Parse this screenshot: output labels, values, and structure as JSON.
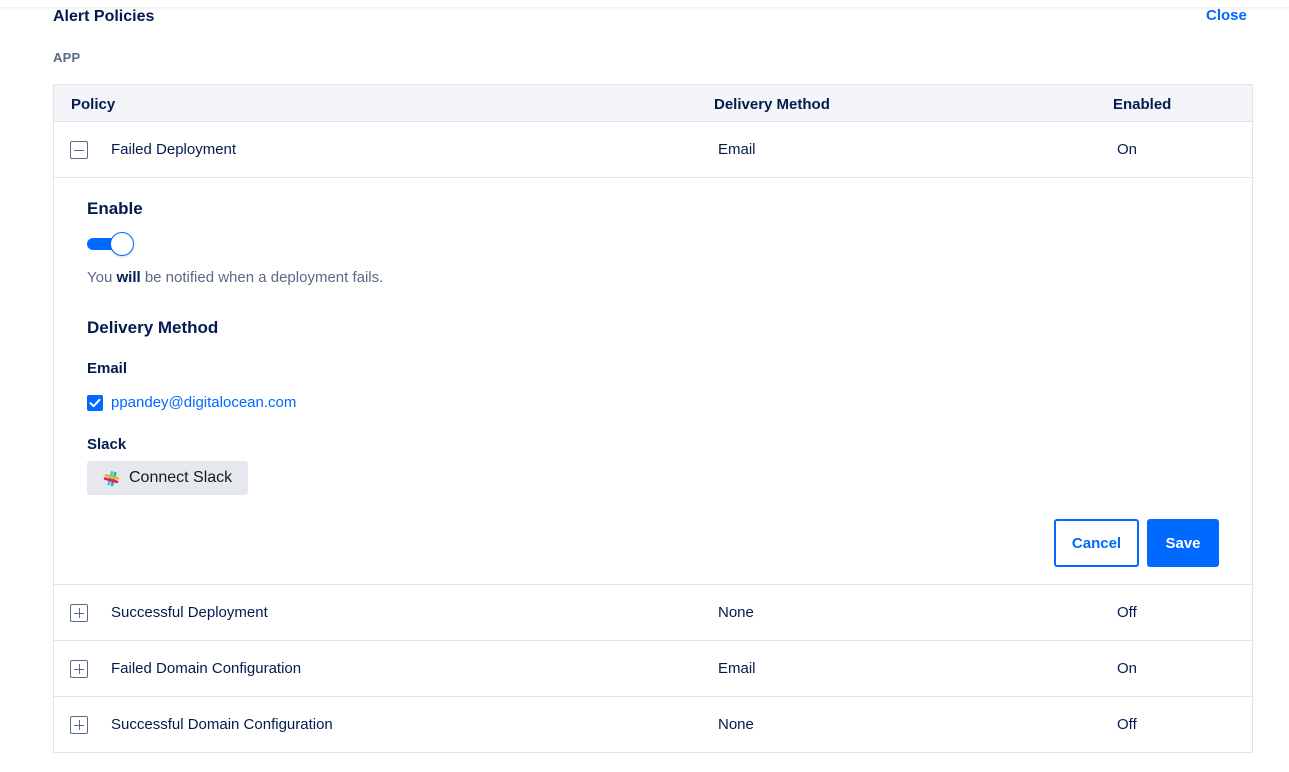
{
  "header": {
    "title": "Alert Policies",
    "close_label": "Close",
    "section_label": "APP"
  },
  "table": {
    "columns": {
      "policy": "Policy",
      "delivery": "Delivery Method",
      "enabled": "Enabled"
    },
    "rows": [
      {
        "policy": "Failed Deployment",
        "delivery": "Email",
        "enabled": "On",
        "expanded": true
      },
      {
        "policy": "Successful Deployment",
        "delivery": "None",
        "enabled": "Off",
        "expanded": false
      },
      {
        "policy": "Failed Domain Configuration",
        "delivery": "Email",
        "enabled": "On",
        "expanded": false
      },
      {
        "policy": "Successful Domain Configuration",
        "delivery": "None",
        "enabled": "Off",
        "expanded": false
      }
    ]
  },
  "panel": {
    "enable_heading": "Enable",
    "toggle_on": true,
    "notify_prefix": "You ",
    "notify_bold": "will",
    "notify_suffix": " be notified when a deployment fails.",
    "delivery_heading": "Delivery Method",
    "email_heading": "Email",
    "email_checked": true,
    "email_address": "ppandey@digitalocean.com",
    "slack_heading": "Slack",
    "slack_button_label": "Connect Slack",
    "cancel_label": "Cancel",
    "save_label": "Save"
  },
  "icons": {
    "collapse": "minus-square-icon",
    "expand": "plus-square-icon",
    "checkmark": "checkmark-icon",
    "slack": "slack-logo-icon"
  },
  "colors": {
    "accent": "#0069ff",
    "text_primary": "#031b4e",
    "text_secondary": "#5b6987",
    "header_bg": "#f3f5f9",
    "border": "#dfe3ea",
    "slack_button_bg": "#e5e8ed"
  }
}
